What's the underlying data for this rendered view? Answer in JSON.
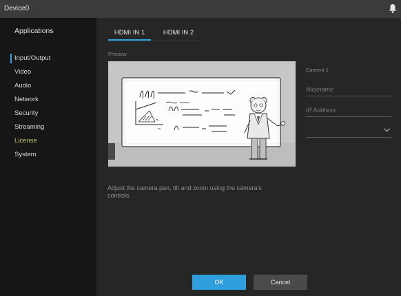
{
  "window": {
    "title": "Device0",
    "notification_icon": "bell-icon"
  },
  "sidebar": {
    "heading": "Applications",
    "items": [
      {
        "label": "Input/Output",
        "active": true
      },
      {
        "label": "Video"
      },
      {
        "label": "Audio"
      },
      {
        "label": "Network"
      },
      {
        "label": "Security"
      },
      {
        "label": "Streaming"
      },
      {
        "label": "License"
      },
      {
        "label": "System"
      }
    ]
  },
  "tabs": [
    {
      "label": "HDMI IN 1",
      "active": true
    },
    {
      "label": "HDMI IN 2"
    }
  ],
  "preview": {
    "label": "Preview"
  },
  "camera": {
    "label": "Camera 1",
    "nickname_placeholder": "Nickname",
    "ip_placeholder": "IP Address",
    "select_value": ""
  },
  "hint": "Adjust the camera pan, tilt and zoom using the camera's controls.",
  "buttons": {
    "ok": "OK",
    "cancel": "Cancel"
  },
  "colors": {
    "accent": "#29a3e6",
    "ok_button": "#2e9fdc",
    "license_text": "#c5c26f"
  }
}
